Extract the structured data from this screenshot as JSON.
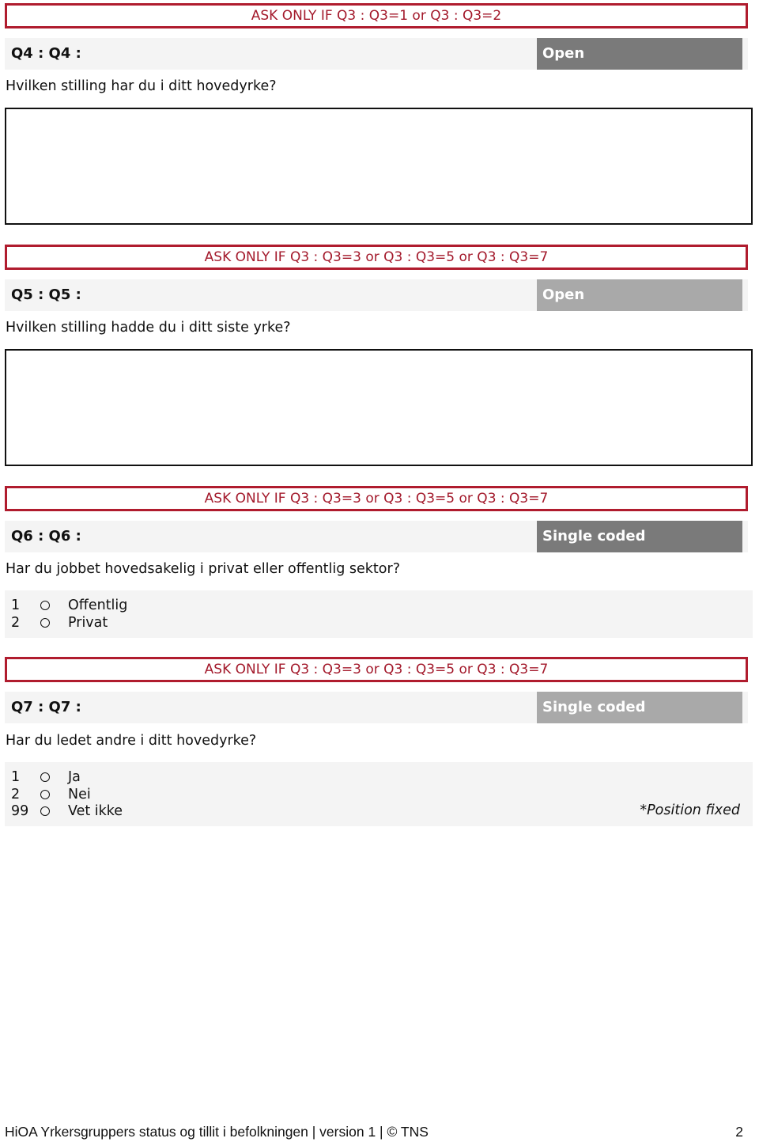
{
  "questions": [
    {
      "condition": "ASK ONLY IF Q3 : Q3=1 or Q3 : Q3=2",
      "id": "Q4 : Q4 :",
      "type": "Open",
      "type_color": "#7a7a7a",
      "text": "Hvilken stilling har du i ditt hovedyrke?",
      "answer_value": ""
    },
    {
      "condition": "ASK ONLY IF Q3 : Q3=3 or Q3 : Q3=5 or Q3 : Q3=7",
      "id": "Q5 : Q5 :",
      "type": "Open",
      "type_color": "#a9a9a9",
      "text": "Hvilken stilling hadde du i ditt siste yrke?",
      "answer_value": ""
    },
    {
      "condition": "ASK ONLY IF Q3 : Q3=3 or Q3 : Q3=5 or Q3 : Q3=7",
      "id": "Q6 : Q6 :",
      "type": "Single coded",
      "type_color": "#7a7a7a",
      "text": "Har du jobbet hovedsakelig i privat eller offentlig sektor?",
      "options": [
        {
          "code": "1",
          "label": "Offentlig"
        },
        {
          "code": "2",
          "label": "Privat"
        }
      ]
    },
    {
      "condition": "ASK ONLY IF Q3 : Q3=3 or Q3 : Q3=5 or Q3 : Q3=7",
      "id": "Q7 : Q7 :",
      "type": "Single coded",
      "type_color": "#a9a9a9",
      "text": "Har du ledet andre i ditt hovedyrke?",
      "options": [
        {
          "code": "1",
          "label": "Ja"
        },
        {
          "code": "2",
          "label": "Nei"
        },
        {
          "code": "99",
          "label": "Vet ikke"
        }
      ],
      "note": "*Position fixed"
    }
  ],
  "footer": {
    "title": "HiOA Yrkersgruppers status og tillit i befolkningen | version 1 | © TNS",
    "page_number": "2"
  },
  "colors": {
    "condition_red": "#b01c2e",
    "header_bg": "#f4f4f4"
  }
}
